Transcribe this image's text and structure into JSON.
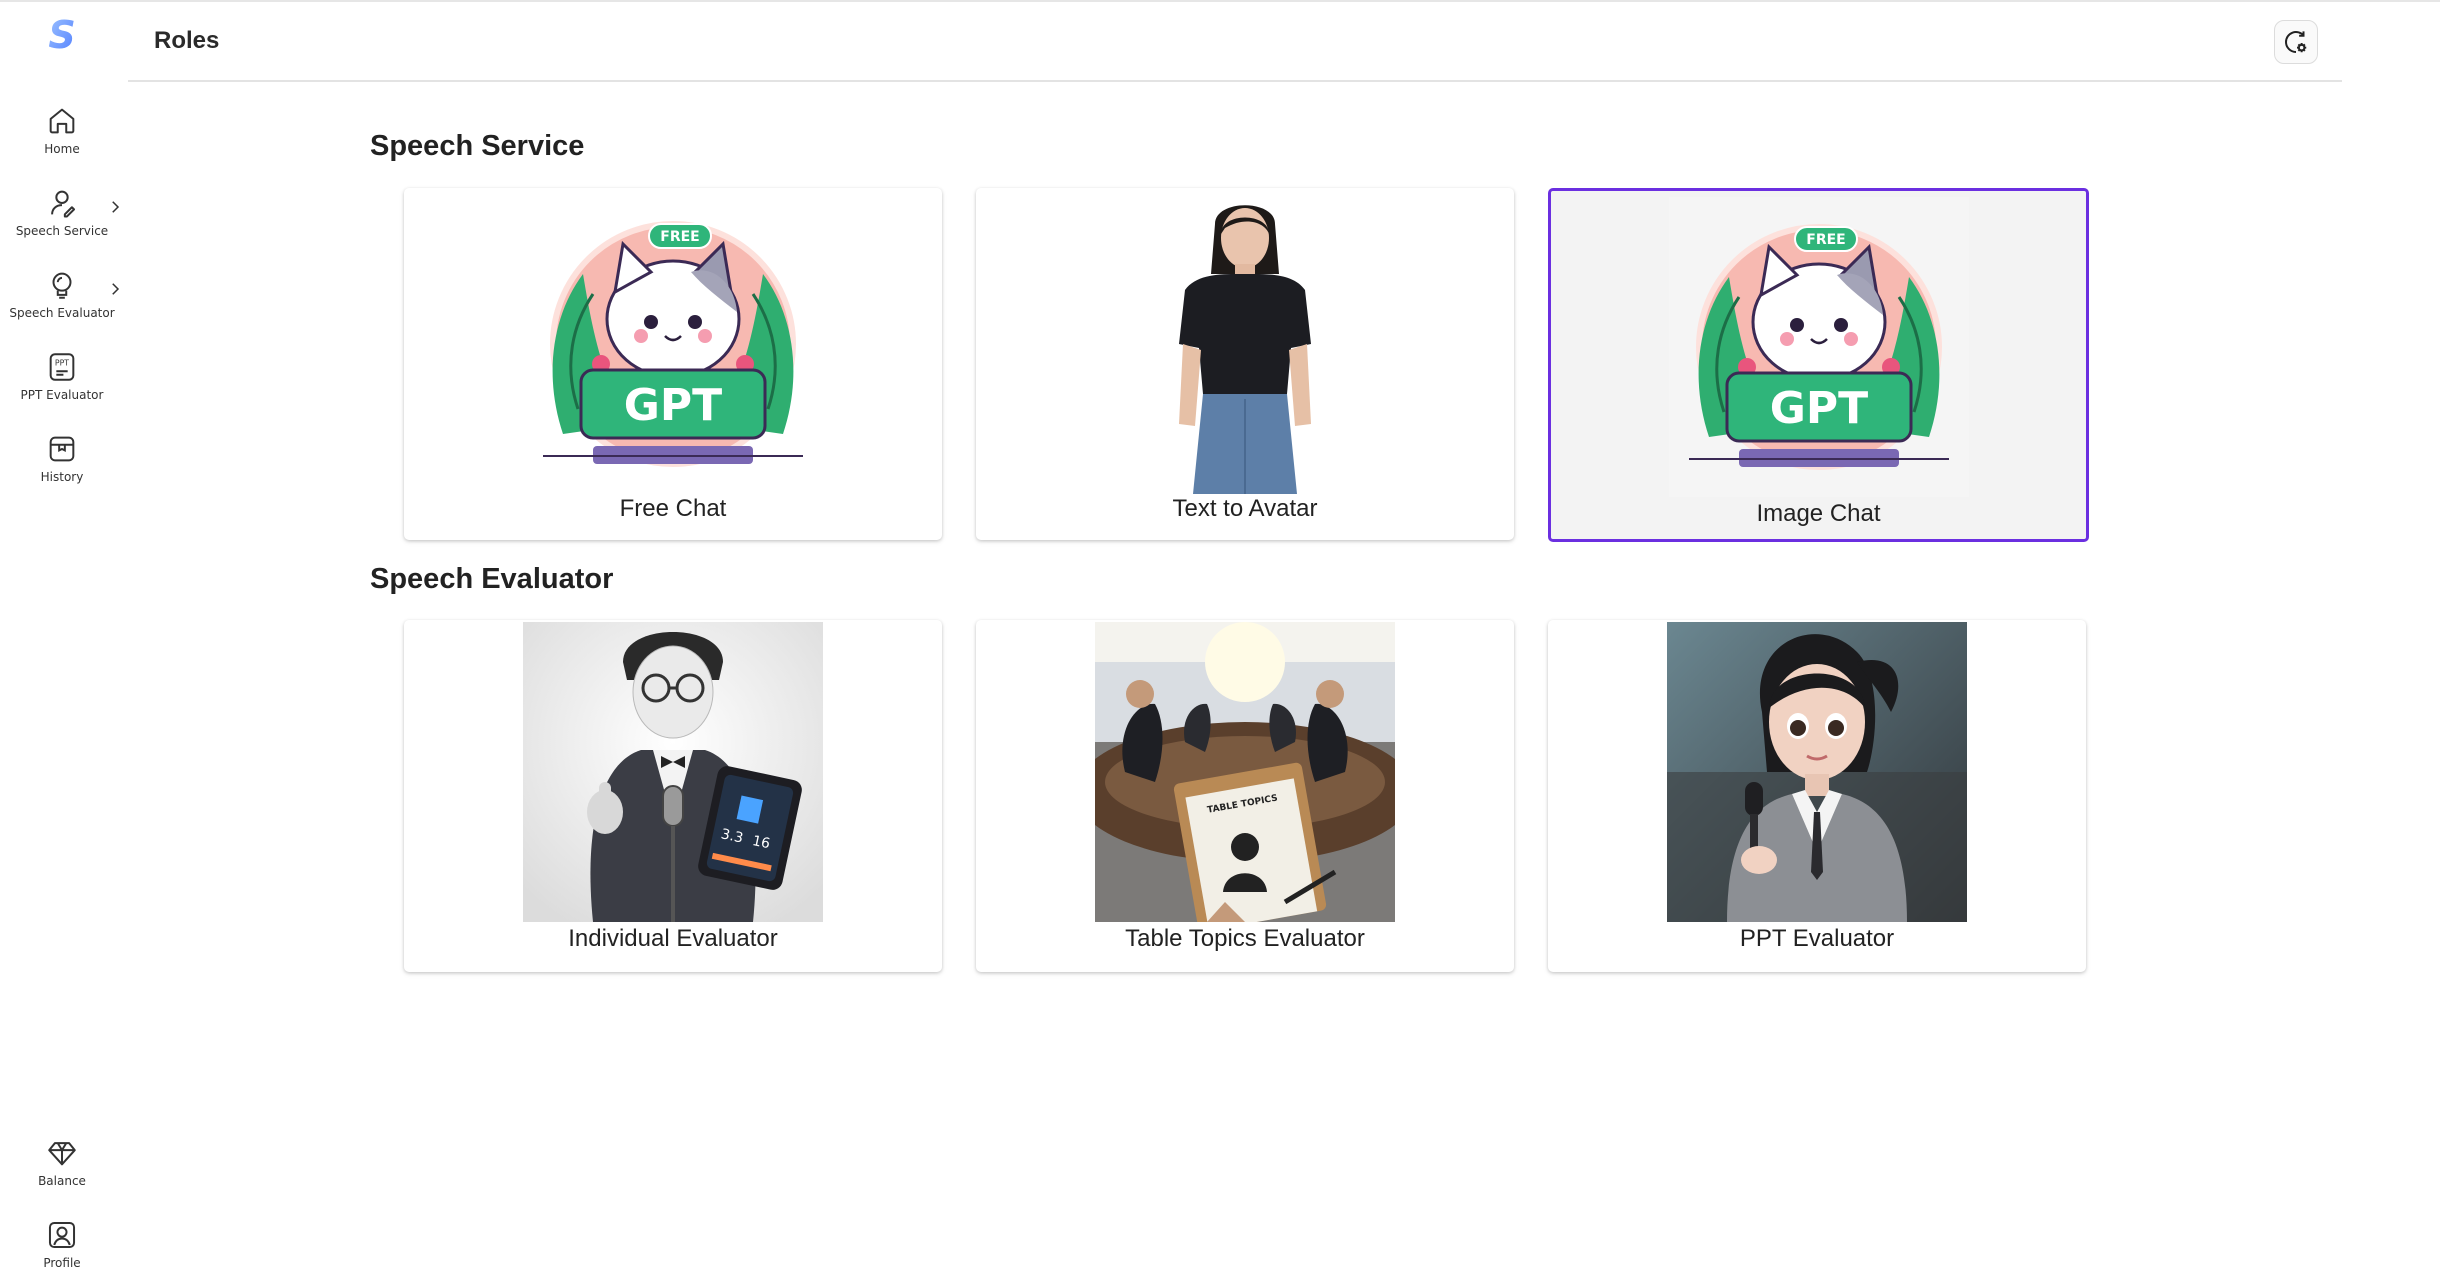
{
  "app": {
    "logo_letter": "S",
    "accent": "#6b2fe0"
  },
  "sidebar": {
    "items": [
      {
        "label": "Home",
        "icon": "home-icon"
      },
      {
        "label": "Speech Service",
        "icon": "pen-icon",
        "expandable": true
      },
      {
        "label": "Speech Evaluator",
        "icon": "lightbulb-icon",
        "expandable": true
      },
      {
        "label": "PPT Evaluator",
        "icon": "ppt-icon"
      },
      {
        "label": "History",
        "icon": "history-icon"
      }
    ],
    "bottom": [
      {
        "label": "Balance",
        "icon": "diamond-icon"
      },
      {
        "label": "Profile",
        "icon": "profile-icon"
      }
    ]
  },
  "header": {
    "title": "Roles",
    "action_icon": "settings-refresh-icon"
  },
  "sections": [
    {
      "title": "Speech Service",
      "cards": [
        {
          "label": "Free Chat",
          "badge": "FREE",
          "sign": "GPT",
          "selected": false
        },
        {
          "label": "Text to Avatar",
          "selected": false
        },
        {
          "label": "Image Chat",
          "badge": "FREE",
          "sign": "GPT",
          "selected": true
        }
      ]
    },
    {
      "title": "Speech Evaluator",
      "cards": [
        {
          "label": "Individual Evaluator",
          "tablet_values": [
            "3.3",
            "16"
          ]
        },
        {
          "label": "Table Topics Evaluator",
          "clipboard_text": "TABLE TOPICS"
        },
        {
          "label": "PPT Evaluator"
        }
      ]
    }
  ]
}
